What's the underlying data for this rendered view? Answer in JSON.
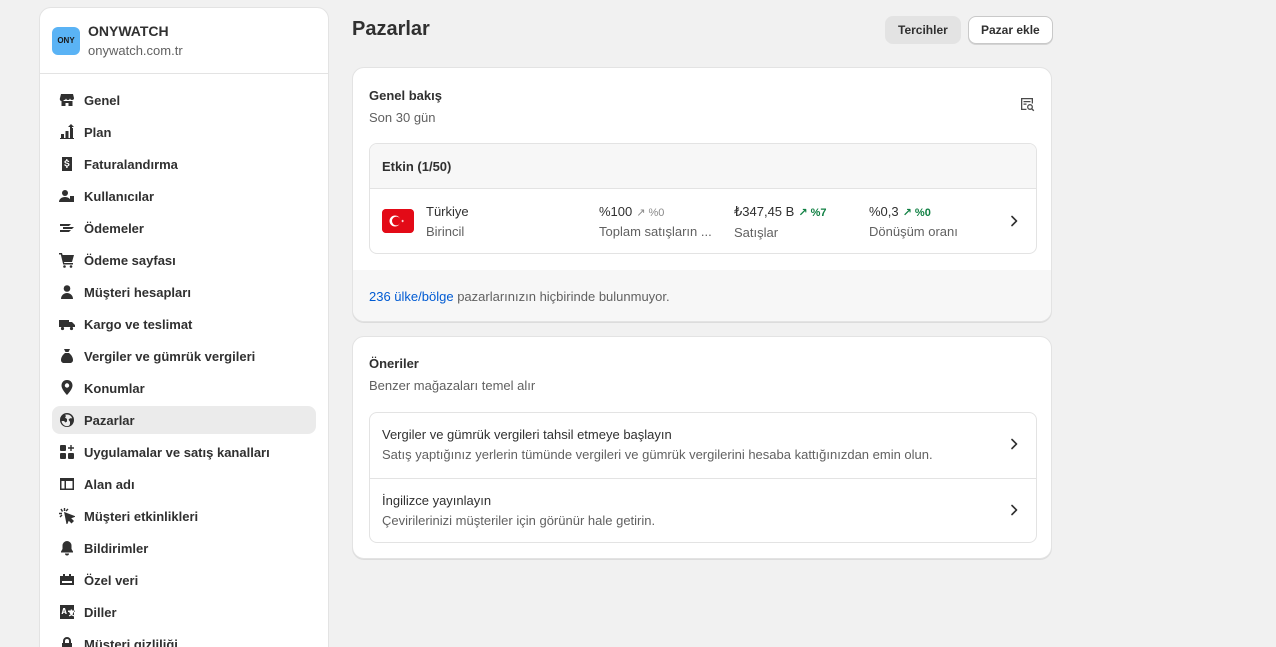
{
  "store": {
    "logo_text": "ONY",
    "name": "ONYWATCH",
    "domain": "onywatch.com.tr"
  },
  "sidebar": {
    "items": [
      {
        "label": "Genel",
        "icon": "store-icon"
      },
      {
        "label": "Plan",
        "icon": "plan-icon"
      },
      {
        "label": "Faturalandırma",
        "icon": "billing-icon"
      },
      {
        "label": "Kullanıcılar",
        "icon": "users-icon"
      },
      {
        "label": "Ödemeler",
        "icon": "payments-icon"
      },
      {
        "label": "Ödeme sayfası",
        "icon": "cart-icon"
      },
      {
        "label": "Müşteri hesapları",
        "icon": "person-icon"
      },
      {
        "label": "Kargo ve teslimat",
        "icon": "truck-icon"
      },
      {
        "label": "Vergiler ve gümrük vergileri",
        "icon": "tax-icon"
      },
      {
        "label": "Konumlar",
        "icon": "location-icon"
      },
      {
        "label": "Pazarlar",
        "icon": "globe-icon",
        "active": true
      },
      {
        "label": "Uygulamalar ve satış kanalları",
        "icon": "apps-icon"
      },
      {
        "label": "Alan adı",
        "icon": "domain-icon"
      },
      {
        "label": "Müşteri etkinlikleri",
        "icon": "cursor-icon"
      },
      {
        "label": "Bildirimler",
        "icon": "bell-icon"
      },
      {
        "label": "Özel veri",
        "icon": "data-icon"
      },
      {
        "label": "Diller",
        "icon": "language-icon"
      },
      {
        "label": "Müşteri gizliliği",
        "icon": "lock-icon"
      }
    ]
  },
  "header": {
    "title": "Pazarlar",
    "preferences_label": "Tercihler",
    "add_market_label": "Pazar ekle"
  },
  "overview": {
    "title": "Genel bakış",
    "subtitle": "Son 30 gün",
    "active_header": "Etkin (1/50)",
    "market": {
      "name": "Türkiye",
      "role": "Birincil",
      "share_value": "%100",
      "share_delta": "%0",
      "share_label": "Toplam satışların ...",
      "sales_value": "₺347,45 B",
      "sales_delta": "%7",
      "sales_label": "Satışlar",
      "conversion_value": "%0,3",
      "conversion_delta": "%0",
      "conversion_label": "Dönüşüm oranı"
    },
    "footer_link": "236 ülke/bölge",
    "footer_text": " pazarlarınızın hiçbirinde bulunmuyor."
  },
  "recommendations": {
    "title": "Öneriler",
    "subtitle": "Benzer mağazaları temel alır",
    "items": [
      {
        "title": "Vergiler ve gümrük vergileri tahsil etmeye başlayın",
        "desc": "Satış yaptığınız yerlerin tümünde vergileri ve gümrük vergilerini hesaba kattığınızdan emin olun."
      },
      {
        "title": "İngilizce yayınlayın",
        "desc": "Çevirilerinizi müşteriler için görünür hale getirin."
      }
    ]
  },
  "colors": {
    "accent_link": "#005bd3",
    "positive": "#108043",
    "flag_red": "#e30a17",
    "logo_bg": "#5ab3f5"
  }
}
